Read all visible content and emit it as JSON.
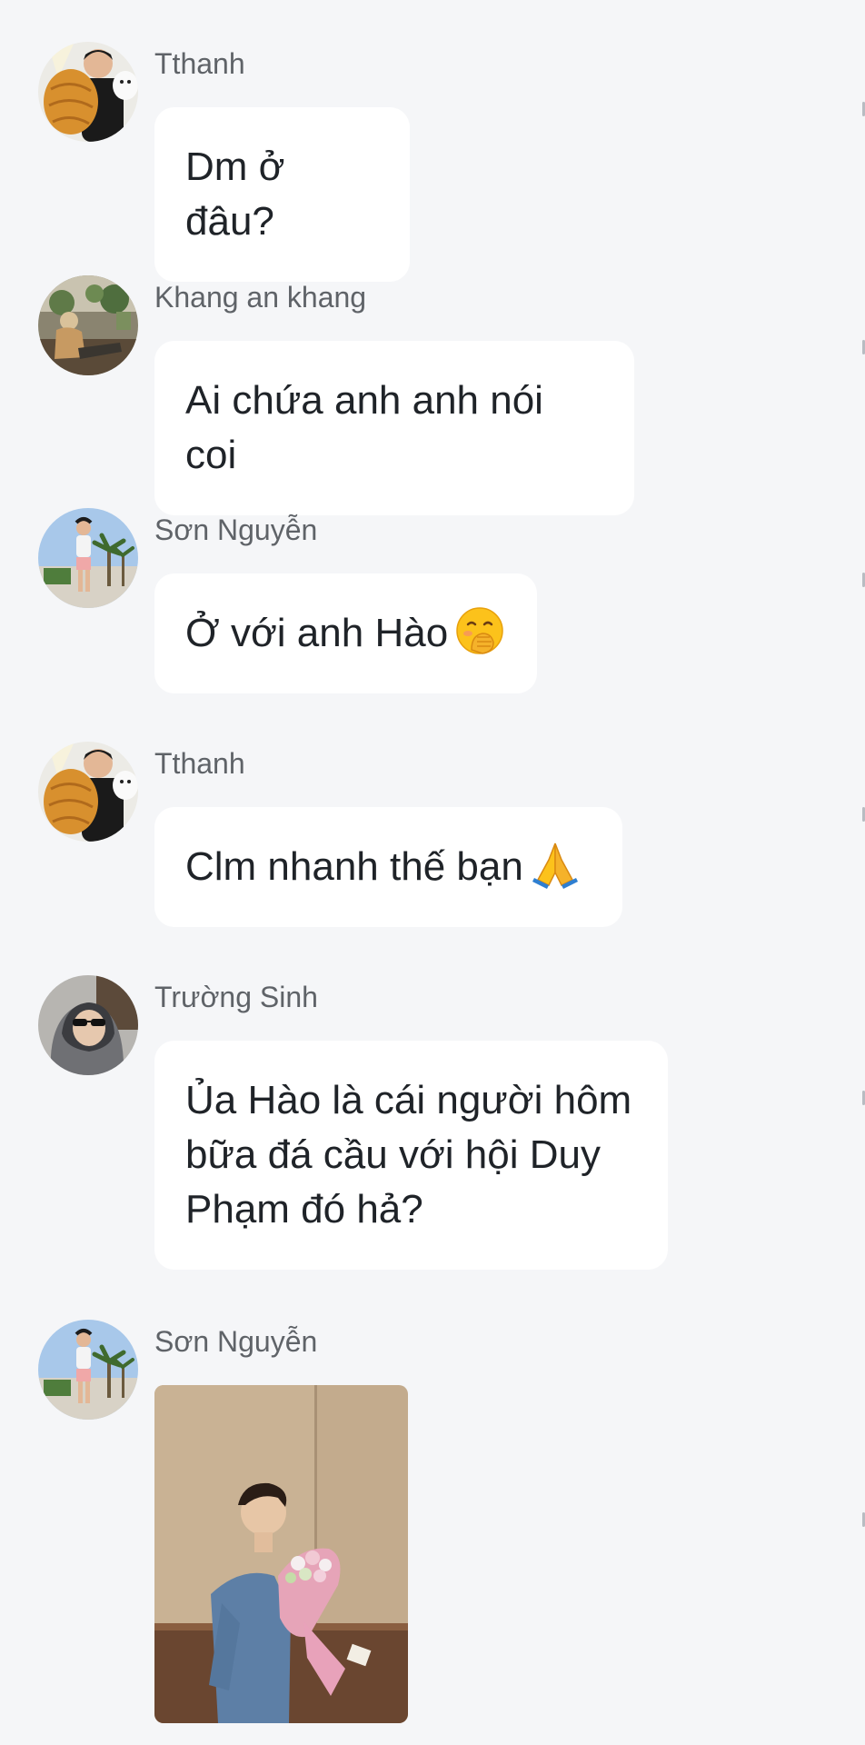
{
  "messages": [
    {
      "sender": "Tthanh",
      "text": "Dm ở đâu?",
      "avatar": "bread-hug-avatar"
    },
    {
      "sender": "Khang an khang",
      "text": "Ai chứa anh anh nói coi",
      "avatar": "seated-man-avatar"
    },
    {
      "sender": "Sơn Nguyễn",
      "text": "Ở với anh Hào",
      "emoji": "face-with-hand-over-mouth-emoji",
      "avatar": "palm-tree-avatar"
    },
    {
      "sender": "Tthanh",
      "text": "Clm nhanh thế bạn",
      "emoji": "folded-hands-emoji",
      "avatar": "bread-hug-avatar"
    },
    {
      "sender": "Trường Sinh",
      "text": "Ủa Hào là cái người hôm bữa đá cầu với hội Duy Phạm đó hả?",
      "avatar": "hooded-sunglasses-avatar"
    },
    {
      "sender": "Sơn Nguyễn",
      "image": "man-holding-flower-bouquet-photo",
      "avatar": "palm-tree-avatar"
    }
  ],
  "colors": {
    "background": "#f5f6f8",
    "bubble": "#ffffff",
    "sender_text": "#5f6368",
    "message_text": "#1f2328"
  }
}
